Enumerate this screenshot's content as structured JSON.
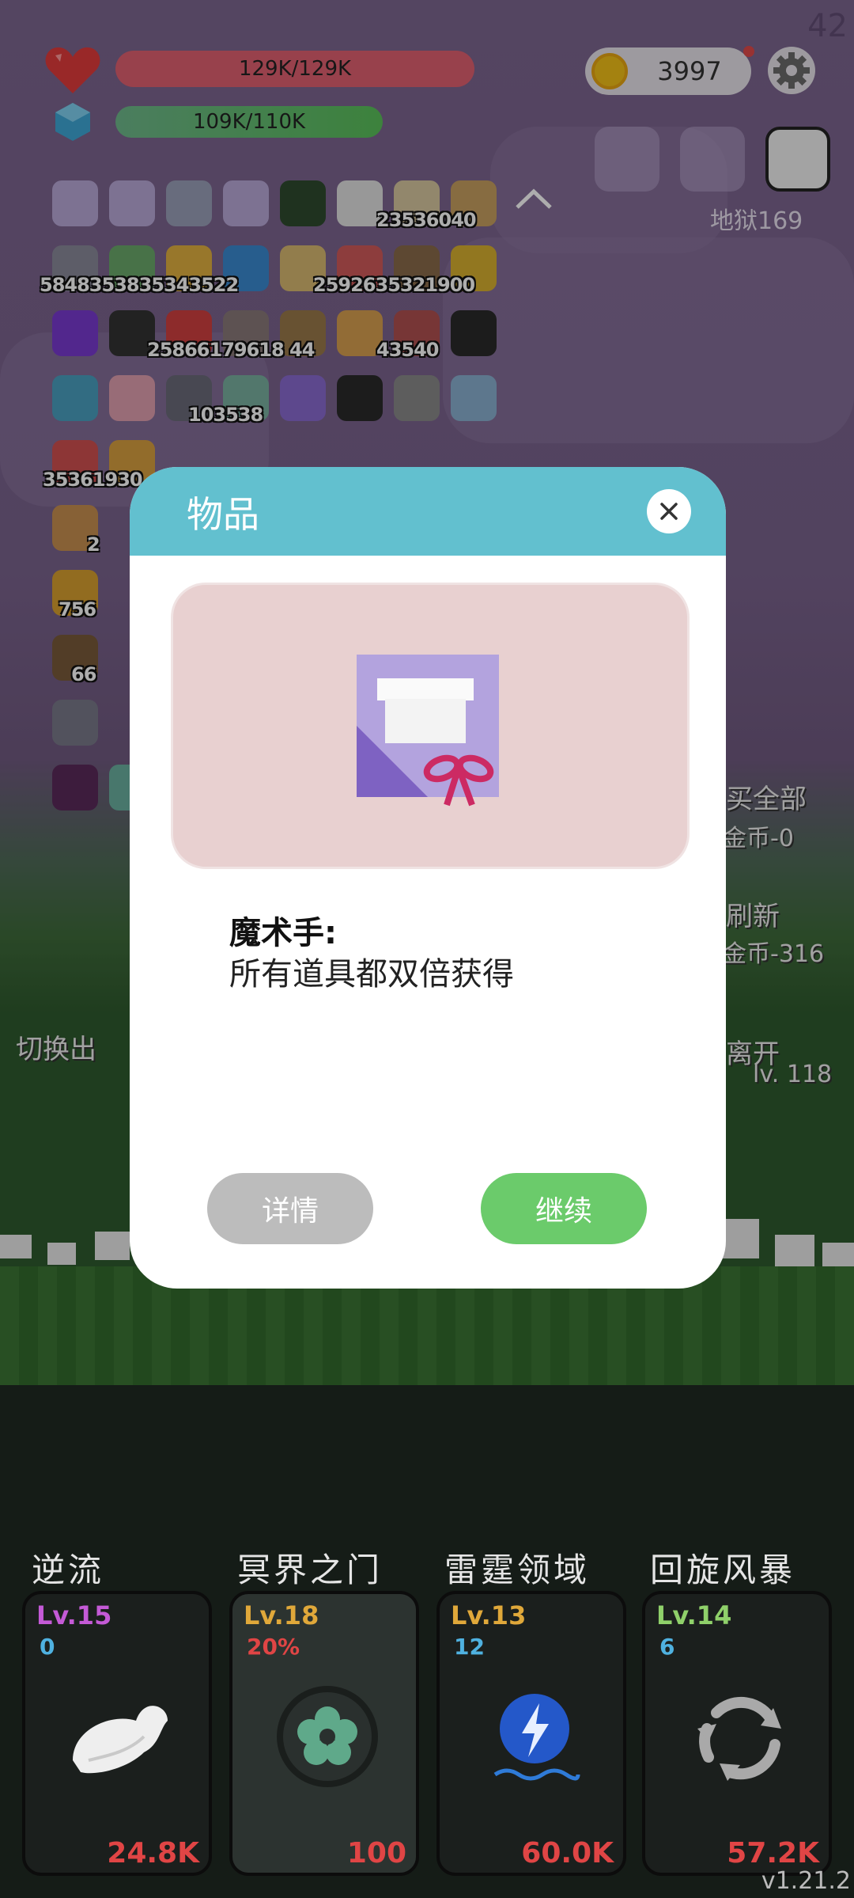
{
  "hud": {
    "corner_number": "42",
    "hp_text": "129K/129K",
    "mp_text": "109K/110K",
    "coins": "3997",
    "hell_level": "地狱169"
  },
  "inventory": {
    "row2_counts": "5848353835343522",
    "row2_counts_b": "2592635321900",
    "row1_counts": "23536040",
    "row3_counts": "25866179618 44",
    "row3_counts_b": "43540",
    "row4_counts": "103538",
    "row5_counts": "35361930",
    "row7_counts": "756",
    "row8_counts": "66",
    "small_count": "2"
  },
  "side": {
    "buy_all": "买全部",
    "buy_all_cost": "金币-0",
    "refresh": "刷新",
    "refresh_cost": "金币-316",
    "switch": "切换出",
    "leave": "离开",
    "lv_right": "lv. 118"
  },
  "dialog": {
    "title": "物品",
    "item_name": "魔术手:",
    "item_desc": "所有道具都双倍获得",
    "detail_button": "详情",
    "continue_button": "继续"
  },
  "skills": [
    {
      "name": "逆流",
      "level": "Lv.15",
      "sub": "0",
      "cost": "24.8K",
      "level_color": "#c45ad6",
      "sub_color": "#4fb1e0",
      "icon": "wing-icon"
    },
    {
      "name": "冥界之门",
      "level": "Lv.18",
      "sub": "20%",
      "cost": "100",
      "level_color": "#e0a83a",
      "sub_color": "#e04545",
      "icon": "portal-flower-icon"
    },
    {
      "name": "雷霆领域",
      "level": "Lv.13",
      "sub": "12",
      "cost": "60.0K",
      "level_color": "#e0a83a",
      "sub_color": "#4fb1e0",
      "icon": "lightning-orb-icon"
    },
    {
      "name": "回旋风暴",
      "level": "Lv.14",
      "sub": "6",
      "cost": "57.2K",
      "level_color": "#8fd06a",
      "sub_color": "#4fb1e0",
      "icon": "cyclone-icon"
    }
  ],
  "version": "v1.21.2"
}
